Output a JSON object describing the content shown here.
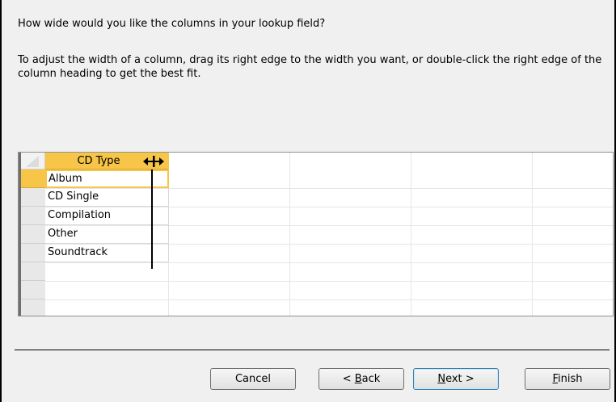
{
  "wizard": {
    "prompt": "How wide would you like the columns in your lookup field?",
    "instructions": "To adjust the width of a column, drag its right edge to the width you want, or double-click the right edge of the column heading to get the best fit."
  },
  "grid": {
    "column_header": "CD Type",
    "rows": [
      "Album",
      "CD Single",
      "Compilation",
      "Other",
      "Soundtrack"
    ]
  },
  "buttons": {
    "cancel": "Cancel",
    "back": {
      "prefix": "< ",
      "accel": "B",
      "rest": "ack"
    },
    "next": {
      "accel": "N",
      "rest": "ext >"
    },
    "finish": {
      "accel": "F",
      "rest": "inish"
    }
  },
  "icons": {
    "resize_cursor": "column-resize-cursor-icon",
    "corner": "select-all-corner-icon"
  },
  "colors": {
    "selection": "#f7c547",
    "dialog_bg": "#f0f0f0"
  }
}
